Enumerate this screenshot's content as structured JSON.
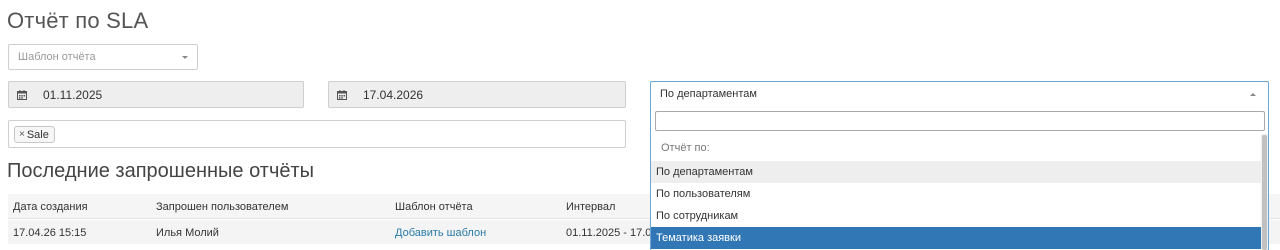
{
  "page": {
    "title": "Отчёт по SLA"
  },
  "template_select": {
    "placeholder": "Шаблон отчёта"
  },
  "date_from": {
    "icon": "calendar-icon",
    "value": "01.11.2025"
  },
  "date_to": {
    "icon": "calendar-icon",
    "value": "17.04.2026"
  },
  "tags": [
    {
      "label": "Sale",
      "remove_glyph": "×"
    }
  ],
  "report_by": {
    "selected": "По департаментам",
    "search_value": "",
    "group_label": "Отчёт по:",
    "options": [
      {
        "label": "По департаментам",
        "state": "hover"
      },
      {
        "label": "По пользователям",
        "state": "normal"
      },
      {
        "label": "По сотрудникам",
        "state": "normal"
      },
      {
        "label": "Тематика заявки",
        "state": "selected"
      }
    ]
  },
  "recent": {
    "title": "Последние запрошенные отчёты",
    "columns": [
      "Дата создания",
      "Запрошен пользователем",
      "Шаблон отчёта",
      "Интервал"
    ],
    "rows": [
      {
        "created": "17.04.26 15:15",
        "user": "Илья Молий",
        "template": "Добавить шаблон",
        "interval": "01.11.2025 - 17.0"
      }
    ]
  },
  "colors": {
    "accent": "#3277b5",
    "link": "#2a7aa8",
    "focus_border": "#6aa6d6"
  }
}
